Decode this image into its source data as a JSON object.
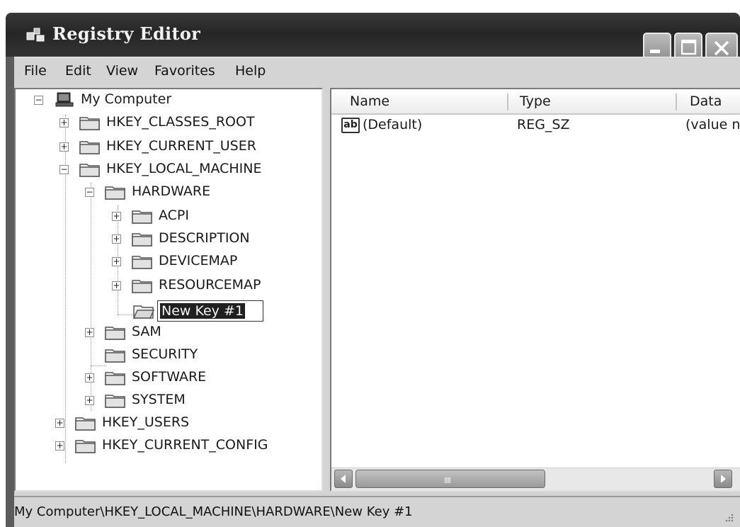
{
  "window": {
    "title": "Registry Editor",
    "accent_color": "#262626"
  },
  "menu": [
    "File",
    "Edit",
    "View",
    "Favorites",
    "Help"
  ],
  "tree": {
    "root": "My Computer",
    "hives": {
      "classes_root": "HKEY_CLASSES_ROOT",
      "current_user": "HKEY_CURRENT_USER",
      "local_machine": "HKEY_LOCAL_MACHINE",
      "users": "HKEY_USERS",
      "current_config": "HKEY_CURRENT_CONFIG"
    },
    "hardware": {
      "label": "HARDWARE",
      "children": [
        "ACPI",
        "DESCRIPTION",
        "DEVICEMAP",
        "RESOURCEMAP"
      ],
      "new_key": "New Key #1"
    },
    "local_machine_children": {
      "sam": "SAM",
      "security": "SECURITY",
      "software": "SOFTWARE",
      "system": "SYSTEM"
    },
    "expander_collapsed": "+",
    "expander_expanded": "−"
  },
  "list": {
    "columns": [
      "Name",
      "Type",
      "Data"
    ],
    "rows": [
      {
        "icon": "ab",
        "name": "(Default)",
        "type": "REG_SZ",
        "data": "(value n"
      }
    ],
    "scroll_grip": "IIII"
  },
  "status": {
    "path": "My Computer\\HKEY_LOCAL_MACHINE\\HARDWARE\\New Key #1"
  }
}
